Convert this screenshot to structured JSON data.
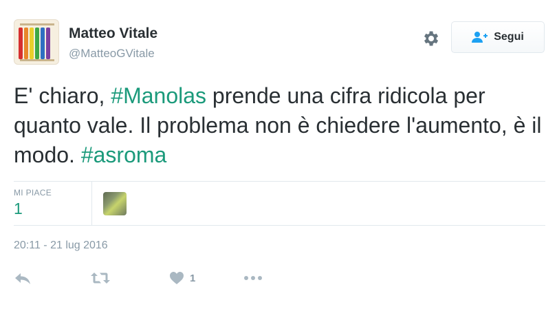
{
  "author": {
    "name": "Matteo Vitale",
    "handle": "@MatteoGVitale",
    "avatar_icon": "rainbow-bars-avatar"
  },
  "header": {
    "settings_icon": "gear-icon",
    "follow_button": {
      "label": "Segui",
      "icon": "add-user-icon"
    }
  },
  "tweet": {
    "segments": [
      {
        "text": "E' chiaro, ",
        "type": "text"
      },
      {
        "text": "#Manolas",
        "type": "hashtag"
      },
      {
        "text": " prende una cifra ridicola per quanto vale. Il problema non è chiedere l'aumento, è il modo. ",
        "type": "text"
      },
      {
        "text": "#asroma",
        "type": "hashtag"
      }
    ]
  },
  "stats": {
    "likes_label": "MI PIACE",
    "likes_count": "1"
  },
  "timestamp": "20:11 - 21 lug 2016",
  "actions": {
    "reply_icon": "reply-icon",
    "retweet_icon": "retweet-icon",
    "like_icon": "heart-icon",
    "like_count": "1",
    "more_icon": "more-icon"
  },
  "colors": {
    "hashtag": "#1b9a7b",
    "muted": "#8899a6",
    "text": "#292f33",
    "action_icon": "#aab8c2"
  }
}
